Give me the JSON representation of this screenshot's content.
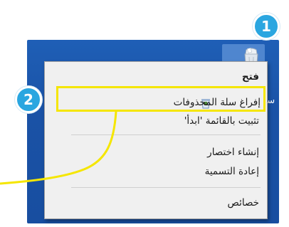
{
  "desktop": {
    "recycle_bin_label": "سلة"
  },
  "context_menu": {
    "items": [
      {
        "label": "فتح",
        "bold": true
      },
      {
        "label": "إفراغ سلة المحذوفات",
        "highlighted": true
      },
      {
        "label": "تثبيت بالقائمة 'ابدأ'"
      },
      {
        "label": "إنشاء اختصار"
      },
      {
        "label": "إعادة التسمية"
      },
      {
        "label": "خصائص"
      }
    ]
  },
  "callouts": {
    "step1": "1",
    "step2": "2"
  },
  "colors": {
    "highlight": "#f5e600",
    "badge": "#2aa6e0",
    "desktop": "#1a52a6"
  }
}
